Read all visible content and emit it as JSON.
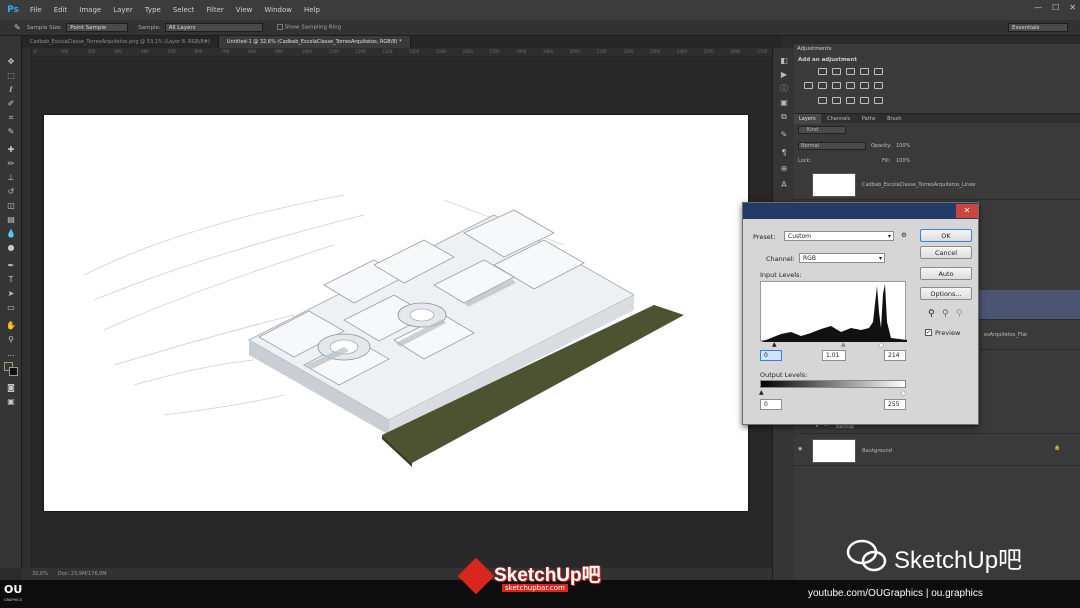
{
  "app": {
    "logo": "Ps",
    "menu": [
      "File",
      "Edit",
      "Image",
      "Layer",
      "Type",
      "Select",
      "Filter",
      "View",
      "Window",
      "Help"
    ],
    "workspace": "Essentials"
  },
  "options_bar": {
    "sample_size_label": "Sample Size:",
    "sample_size_value": "Point Sample",
    "sample_label": "Sample:",
    "sample_value": "All Layers",
    "show_ring_label": "Show Sampling Ring"
  },
  "doc_tabs": [
    {
      "label": "Cadbab_EscolaClasse_TorreoArquitetos.png @ 53,1% (Layer 8, RGB/8#)",
      "active": false
    },
    {
      "label": "Untitled-1 @ 32,6% (Cadbab_EscolaClasse_TorreoArquitetos, RGB/8) *",
      "active": true
    }
  ],
  "ruler_ticks": [
    "0",
    "100",
    "200",
    "300",
    "400",
    "500",
    "600",
    "700",
    "800",
    "900",
    "1000",
    "1100",
    "1200",
    "1300",
    "1400",
    "1500",
    "1600",
    "1700",
    "1800",
    "1900",
    "2000",
    "2100",
    "2200",
    "2300",
    "2400",
    "2500",
    "2600",
    "2700"
  ],
  "status_bar": {
    "zoom": "32,6%",
    "doc": "Doc: 23,9M/176,0M"
  },
  "adjustments": {
    "title": "Adjustments",
    "subtitle": "Add an adjustment"
  },
  "layers_panel": {
    "tabs": [
      "Layers",
      "Channels",
      "Paths",
      "Brush"
    ],
    "kind_label": "Kind",
    "blend_mode": "Normal",
    "opacity_label": "Opacity:",
    "opacity_value": "100%",
    "lock_label": "Lock:",
    "fill_label": "Fill:",
    "fill_value": "100%",
    "layers": [
      {
        "name": "Cadbab_EscolaClasse_TorreoArquitetos_Linee"
      },
      {
        "name": "esArquitetos_Flat"
      },
      {
        "name": "Backup"
      },
      {
        "name": "Background"
      }
    ]
  },
  "levels_dialog": {
    "preset_label": "Preset:",
    "preset_value": "Custom",
    "channel_label": "Channel:",
    "channel_value": "RGB",
    "input_levels_label": "Input Levels:",
    "input_black": "0",
    "input_gamma": "1,01",
    "input_white": "214",
    "output_levels_label": "Output Levels:",
    "output_black": "0",
    "output_white": "255",
    "buttons": {
      "ok": "OK",
      "cancel": "Cancel",
      "auto": "Auto",
      "options": "Options..."
    },
    "preview_label": "Preview",
    "preview_checked": true,
    "close_glyph": "✕"
  },
  "branding": {
    "ou_logo": "OU",
    "ou_sub": "GRAPHICS",
    "sketchup_logo": "SketchUp吧",
    "sketchup_url": "sketchupbar.com",
    "wechat_text": "SketchUp吧",
    "credit": "youtube.com/OUGraphics  |  ou.graphics"
  }
}
